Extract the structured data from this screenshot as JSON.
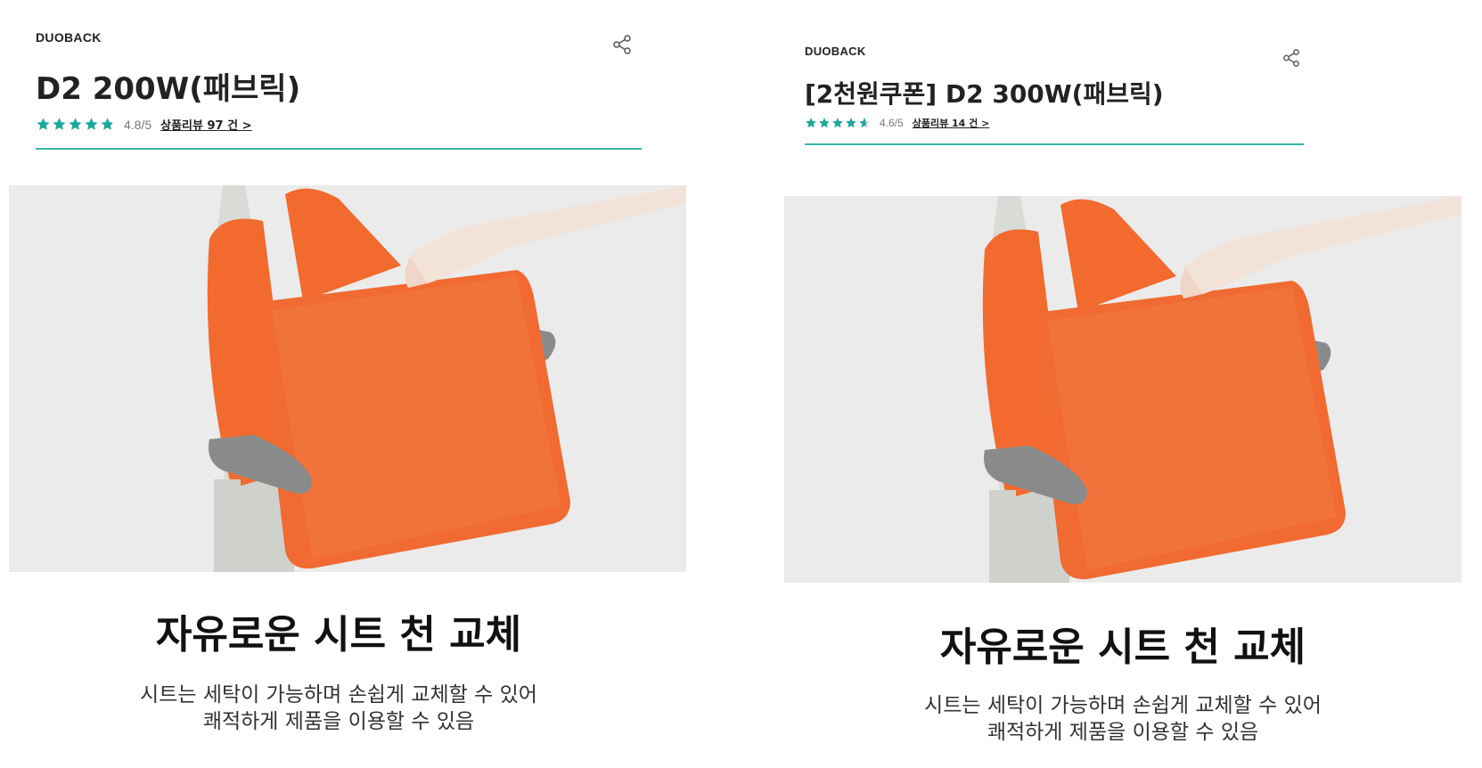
{
  "left": {
    "brand": "DUOBACK",
    "title": "D2 200W(패브릭)",
    "rating": {
      "stars": 4.8,
      "score_text": "4.8/5",
      "review_link": "상품리뷰 97 건 >"
    },
    "feature": {
      "heading": "자유로운 시트 천 교체",
      "line1": "시트는 세탁이 가능하며 손쉽게 교체할 수 있어",
      "line2": "쾌적하게 제품을 이용할 수 있음"
    }
  },
  "right": {
    "brand": "DUOBACK",
    "title": "[2천원쿠폰] D2 300W(패브릭)",
    "rating": {
      "stars": 4.6,
      "score_text": "4.6/5",
      "review_link": "상품리뷰 14 건 >"
    },
    "feature": {
      "heading": "자유로운 시트 천 교체",
      "line1": "시트는 세탁이 가능하며 손쉽게 교체할 수 있어",
      "line2": "쾌적하게 제품을 이용할 수 있음"
    }
  },
  "icons": {
    "share": "share-icon",
    "star": "star-icon"
  },
  "colors": {
    "accent": "#36b5a8",
    "star": "#1aa89c",
    "seat": "#f26a2e",
    "photo_bg": "#ebebeb",
    "armrest": "#8a8a8a"
  }
}
